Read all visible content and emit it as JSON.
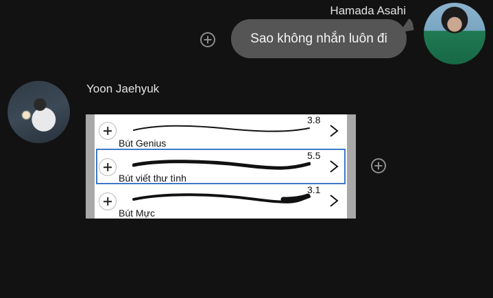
{
  "sent": {
    "sender_name": "Hamada Asahi",
    "message": "Sao không nhắn luôn đi"
  },
  "received": {
    "sender_name": "Yoon Jaehyuk",
    "attachment": {
      "brushes": [
        {
          "label": "Bút Genius",
          "size": "3.8",
          "selected": false
        },
        {
          "label": "Bút viết thư tình",
          "size": "5.5",
          "selected": true
        },
        {
          "label": "Bút Mực",
          "size": "3.1",
          "selected": false
        }
      ]
    }
  },
  "colors": {
    "background": "#121212",
    "bubble": "#555555",
    "selection": "#3a78c8"
  },
  "icons": {
    "react_button": "plus-circle-icon",
    "row_add": "plus-circle-icon",
    "row_open": "chevron-right-icon"
  }
}
